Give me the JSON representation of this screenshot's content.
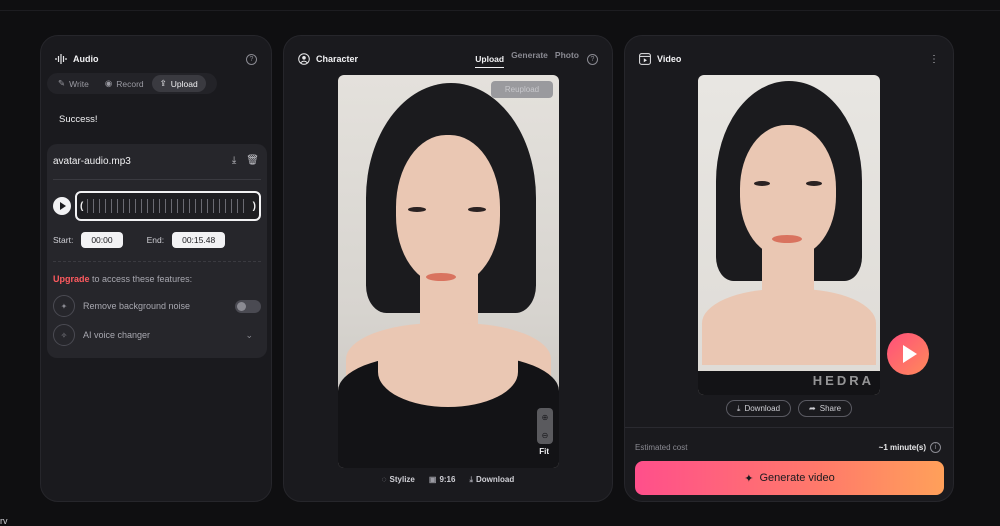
{
  "audio": {
    "title": "Audio",
    "tabs": [
      {
        "label": "Write",
        "icon": "pencil-icon"
      },
      {
        "label": "Record",
        "icon": "record-icon"
      },
      {
        "label": "Upload",
        "icon": "upload-icon",
        "active": true
      }
    ],
    "status": "Success!",
    "file_name": "avatar-audio.mp3",
    "start_label": "Start:",
    "start_value": "00:00",
    "end_label": "End:",
    "end_value": "00:15.48",
    "upgrade_link": "Upgrade",
    "upgrade_text": " to access these features:",
    "features": [
      {
        "label": "Remove background noise",
        "control": "toggle",
        "enabled": false
      },
      {
        "label": "AI voice changer",
        "control": "dropdown"
      }
    ]
  },
  "character": {
    "title": "Character",
    "tabs": [
      {
        "label": "Upload",
        "active": true
      },
      {
        "label": "Generate"
      },
      {
        "label": "Photo"
      }
    ],
    "reupload_label": "Reupload",
    "fit_label": "Fit",
    "toolbar": [
      {
        "label": "Stylize",
        "icon": "stylize-icon"
      },
      {
        "label": "9:16",
        "icon": "aspect-ratio-icon"
      },
      {
        "label": "Download",
        "icon": "download-icon"
      }
    ]
  },
  "video": {
    "title": "Video",
    "watermark": "HEDRA",
    "download_label": "Download",
    "share_label": "Share",
    "cost_label": "Estimated cost",
    "cost_value": "~1 minute(s)",
    "generate_label": "Generate video"
  },
  "stray_text": "rv",
  "colors": {
    "accent_start": "#ff4f8b",
    "accent_end": "#ffa05a",
    "upgrade": "#ff5a5f",
    "panel_bg": "#1a1a1e"
  }
}
